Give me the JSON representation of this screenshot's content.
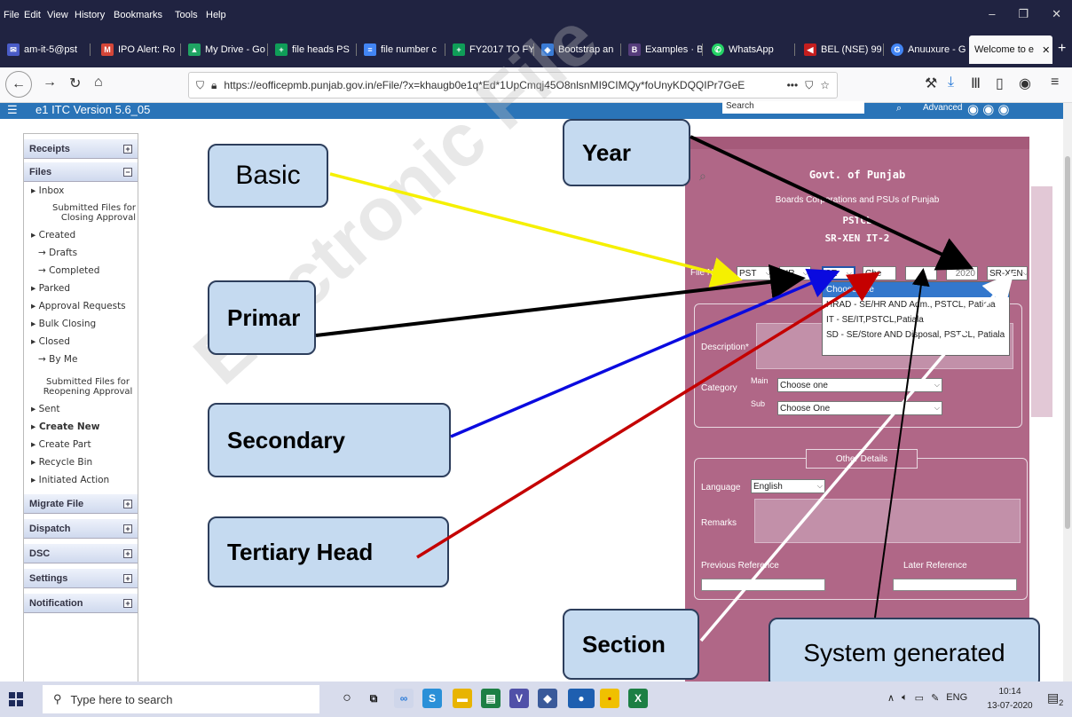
{
  "menubar": {
    "items": [
      "File",
      "Edit",
      "View",
      "History",
      "Bookmarks",
      "Tools",
      "Help"
    ]
  },
  "tabs": [
    {
      "label": "am-it-5@pst",
      "icon": "mail-icon",
      "color": "#4a5cc8"
    },
    {
      "label": "IPO Alert: Ro",
      "icon": "gmail-icon",
      "color": "#d44638"
    },
    {
      "label": "My Drive - Go",
      "icon": "drive-icon",
      "color": "#1fa463"
    },
    {
      "label": "file heads PS",
      "icon": "sheets-plus-icon",
      "color": "#0f9d58"
    },
    {
      "label": "file number c",
      "icon": "docs-icon",
      "color": "#4285f4"
    },
    {
      "label": "FY2017 TO FY",
      "icon": "sheets-plus-icon",
      "color": "#0f9d58"
    },
    {
      "label": "Bootstrap an",
      "icon": "code-icon",
      "color": "#3a7bd5"
    },
    {
      "label": "Examples · B",
      "icon": "bootstrap-icon",
      "color": "#563d7c"
    },
    {
      "label": "WhatsApp",
      "icon": "whatsapp-icon",
      "color": "#25d366"
    },
    {
      "label": "BEL (NSE) 99",
      "icon": "chart-icon",
      "color": "#c41e1e"
    },
    {
      "label": "Anuuxure - G",
      "icon": "google-icon",
      "color": "#4285f4"
    },
    {
      "label": "Welcome to e",
      "icon": "",
      "color": ""
    }
  ],
  "navbar": {
    "url": "https://eofficepmb.punjab.gov.in/eFile/?x=khaugb0e1q*Ed*1UpCmqj45O8nlsnMI9CIMQy*foUnyKDQQIPr7GeE"
  },
  "app": {
    "version": "e1 ITC  Version 5.6_05",
    "search_label": "Search",
    "advanced_label": "Advanced"
  },
  "sidebar": {
    "receipts": "Receipts",
    "files": "Files",
    "inbox": "Inbox",
    "submitted_closing": "Submitted Files for Closing Approval",
    "created": "Created",
    "drafts": "Drafts",
    "completed": "Completed",
    "parked": "Parked",
    "approval_requests": "Approval Requests",
    "bulk_closing": "Bulk Closing",
    "closed": "Closed",
    "by_me": "By Me",
    "submitted_reopening": "Submitted Files for Reopening Approval",
    "sent": "Sent",
    "create_new": "Create New",
    "create_part": "Create Part",
    "recycle_bin": "Recycle Bin",
    "initiated_action": "Initiated Action",
    "migrate_file": "Migrate File",
    "dispatch": "Dispatch",
    "dsc": "DSC",
    "settings": "Settings",
    "notification": "Notification"
  },
  "form": {
    "govt": "Govt. of Punjab",
    "boards": "Boards Corporations and PSUs of Punjab",
    "org": "PSTCL",
    "unit": "SR-XEN IT-2",
    "file_no_label": "File No.",
    "basic": "PST",
    "primary": "HR",
    "secondary": "SE",
    "tertiary": "Che",
    "year": "2020",
    "section": "SR-XEN",
    "dropdown_options": [
      "Choose one",
      "HRAD - SE/HR AND Adm., PSTCL, Patiala",
      "IT - SE/IT,PSTCL,Patiala",
      "SD - SE/Store AND Disposal, PSTCL, Patiala"
    ],
    "description_label": "Description*",
    "category_label": "Category",
    "main_label": "Main",
    "main_value": "Choose one",
    "sub_label": "Sub",
    "sub_value": "Choose One",
    "other_details": "Other Details",
    "language_label": "Language",
    "language_value": "English",
    "remarks_label": "Remarks",
    "prev_ref": "Previous Reference",
    "later_ref": "Later Reference"
  },
  "callouts": {
    "basic": "Basic",
    "year": "Year",
    "primary": "Primar",
    "secondary": "Secondary",
    "tertiary": "Tertiary Head",
    "section": "Section",
    "system": "System generated"
  },
  "watermark": "Electronic File",
  "taskbar": {
    "search_placeholder": "Type here to search",
    "lang": "ENG",
    "time": "10:14",
    "date": "13-07-2020",
    "notifications": "2"
  }
}
